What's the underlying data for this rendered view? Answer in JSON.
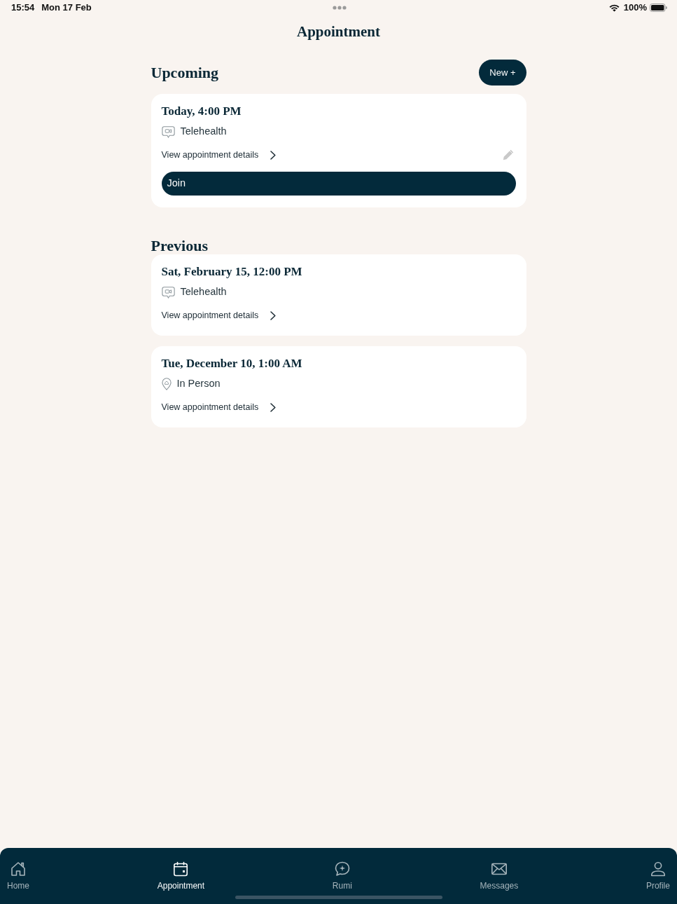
{
  "status_bar": {
    "time": "15:54",
    "date": "Mon 17 Feb",
    "battery": "100%"
  },
  "header": {
    "title": "Appointment"
  },
  "upcoming": {
    "heading": "Upcoming",
    "new_button": "New +",
    "appointments": [
      {
        "datetime": "Today, 4:00 PM",
        "kind": "telehealth",
        "type_label": "Telehealth",
        "details_link": "View appointment details",
        "editable": true,
        "join_button": "Join"
      }
    ]
  },
  "previous": {
    "heading": "Previous",
    "appointments": [
      {
        "datetime": "Sat, February 15, 12:00 PM",
        "kind": "telehealth",
        "type_label": "Telehealth",
        "details_link": "View appointment details",
        "editable": false
      },
      {
        "datetime": "Tue, December 10, 1:00 AM",
        "kind": "in_person",
        "type_label": "In Person",
        "details_link": "View appointment details",
        "editable": false
      }
    ]
  },
  "tab_bar": {
    "tabs": [
      {
        "kind": "home",
        "label": "Home",
        "selected": false
      },
      {
        "kind": "appointment",
        "label": "Appointment",
        "selected": true
      },
      {
        "kind": "assistant",
        "label": "Rumi",
        "selected": false
      },
      {
        "kind": "messages",
        "label": "Messages",
        "selected": false
      },
      {
        "kind": "profile",
        "label": "Profile",
        "selected": false
      }
    ]
  }
}
